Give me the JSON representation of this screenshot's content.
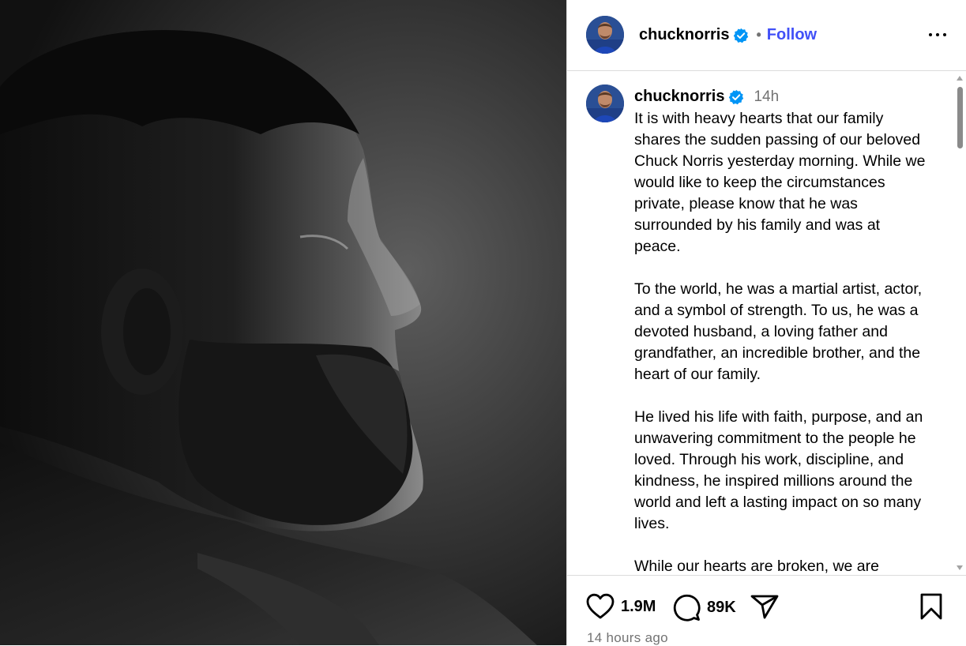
{
  "post": {
    "username": "chucknorris",
    "verified_icon": "verified-badge-icon",
    "separator": "•",
    "follow_label": "Follow",
    "more_icon": "more-options-icon"
  },
  "caption": {
    "username": "chucknorris",
    "time": "14h",
    "text": "It is with heavy hearts that our family shares the sudden passing of our beloved Chuck Norris yesterday morning. While we would like to keep the circumstances private, please know that he was surrounded by his family and was at peace.\n\nTo the world, he was a martial artist, actor, and a symbol of strength. To us, he was a devoted husband, a loving father and grandfather, an incredible brother, and the heart of our family.\n\nHe lived his life with faith, purpose, and an unwavering commitment to the people he loved. Through his work, discipline, and kindness, he inspired millions around the world and left a lasting impact on so many lives.\n\nWhile our hearts are broken, we are"
  },
  "actions": {
    "likes": "1.9M",
    "comments": "89K",
    "like_icon": "heart-icon",
    "comment_icon": "comment-icon",
    "share_icon": "share-icon",
    "save_icon": "bookmark-icon"
  },
  "timestamp": "14 hours ago",
  "colors": {
    "follow": "#4150f7",
    "verified": "#0095f6",
    "muted": "#737373",
    "border": "#dbdbdb"
  }
}
